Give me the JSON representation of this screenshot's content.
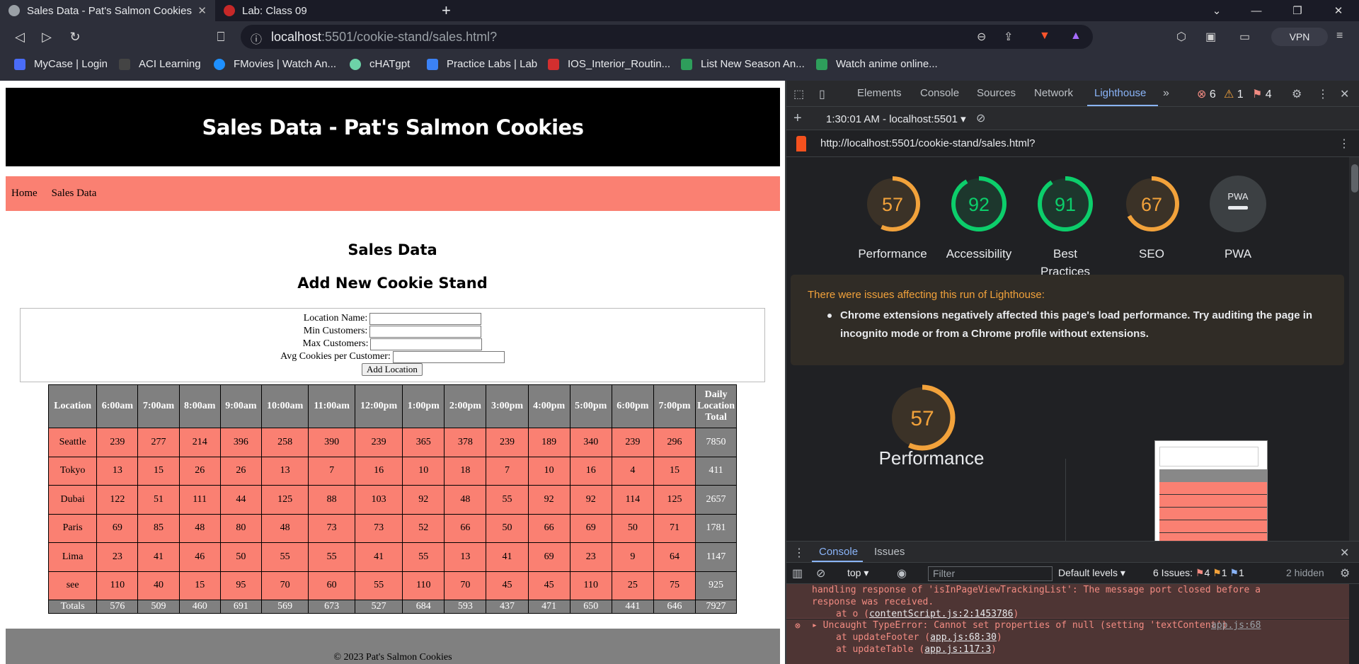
{
  "browser": {
    "tabs": [
      {
        "title": "Sales Data - Pat's Salmon Cookies",
        "active": true
      },
      {
        "title": "Lab: Class 09",
        "active": false
      }
    ],
    "new_tab_label": "+",
    "url_host": "localhost",
    "url_rest": ":5501/cookie-stand/sales.html?",
    "vpn_label": "VPN",
    "bookmarks": [
      "MyCase | Login",
      "ACI Learning",
      "FMovies | Watch An...",
      "cHATgpt",
      "Practice Labs | Lab",
      "IOS_Interior_Routin...",
      "List New Season An...",
      "Watch anime online..."
    ],
    "bookmark_colors": [
      "#4a6cf7",
      "#444444",
      "#1e90ff",
      "#6dd3a8",
      "#3b82f6",
      "#d32f2f",
      "#2e9e5b",
      "#2e9e5b"
    ]
  },
  "site": {
    "title": "Sales Data - Pat's Salmon Cookies",
    "nav": [
      "Home",
      "Sales Data"
    ],
    "heading_sales": "Sales Data",
    "heading_add": "Add New Cookie Stand",
    "form": {
      "location_label": "Location Name:",
      "min_label": "Min Customers:",
      "max_label": "Max Customers:",
      "avg_label": "Avg Cookies per Customer:",
      "submit_label": "Add Location"
    },
    "table": {
      "headers": [
        "Location",
        "6:00am",
        "7:00am",
        "8:00am",
        "9:00am",
        "10:00am",
        "11:00am",
        "12:00pm",
        "1:00pm",
        "2:00pm",
        "3:00pm",
        "4:00pm",
        "5:00pm",
        "6:00pm",
        "7:00pm",
        "Daily Location Total"
      ],
      "rows": [
        [
          "Seattle",
          "239",
          "277",
          "214",
          "396",
          "258",
          "390",
          "239",
          "365",
          "378",
          "239",
          "189",
          "340",
          "239",
          "296",
          "7850"
        ],
        [
          "Tokyo",
          "13",
          "15",
          "26",
          "26",
          "13",
          "7",
          "16",
          "10",
          "18",
          "7",
          "10",
          "16",
          "4",
          "15",
          "411"
        ],
        [
          "Dubai",
          "122",
          "51",
          "111",
          "44",
          "125",
          "88",
          "103",
          "92",
          "48",
          "55",
          "92",
          "92",
          "114",
          "125",
          "2657"
        ],
        [
          "Paris",
          "69",
          "85",
          "48",
          "80",
          "48",
          "73",
          "73",
          "52",
          "66",
          "50",
          "66",
          "69",
          "50",
          "71",
          "1781"
        ],
        [
          "Lima",
          "23",
          "41",
          "46",
          "50",
          "55",
          "55",
          "41",
          "55",
          "13",
          "41",
          "69",
          "23",
          "9",
          "64",
          "1147"
        ],
        [
          "see",
          "110",
          "40",
          "15",
          "95",
          "70",
          "60",
          "55",
          "110",
          "70",
          "45",
          "45",
          "110",
          "25",
          "75",
          "925"
        ]
      ],
      "totals": [
        "Totals",
        "576",
        "509",
        "460",
        "691",
        "569",
        "673",
        "527",
        "684",
        "593",
        "437",
        "471",
        "650",
        "441",
        "646",
        "7927"
      ]
    },
    "footer": "© 2023 Pat's Salmon Cookies"
  },
  "devtools": {
    "tabs": [
      "Elements",
      "Console",
      "Sources",
      "Network",
      "Lighthouse"
    ],
    "active_tab": "Lighthouse",
    "error_count": "6",
    "warning_count": "1",
    "issue_count": "4",
    "run_label": "1:30:01 AM - localhost:5501",
    "report_url": "http://localhost:5501/cookie-stand/sales.html?",
    "scores": [
      {
        "label": "Performance",
        "value": 57,
        "color": "#f2a23b"
      },
      {
        "label": "Accessibility",
        "value": 92,
        "color": "#0cce6b"
      },
      {
        "label": "Best Practices",
        "value": 91,
        "color": "#0cce6b"
      },
      {
        "label": "SEO",
        "value": 67,
        "color": "#f2a23b"
      },
      {
        "label": "PWA",
        "value": null,
        "color": "#9aa0a6"
      }
    ],
    "pwa_badge": "PWA",
    "warning_title": "There were issues affecting this run of Lighthouse:",
    "warning_item": "Chrome extensions negatively affected this page's load performance. Try auditing the page in incognito mode or from a Chrome profile without extensions.",
    "big_score": 57,
    "big_label": "Performance",
    "drawer": {
      "tabs": [
        "Console",
        "Issues"
      ],
      "context": "top",
      "filter_placeholder": "Filter",
      "levels": "Default levels",
      "issues_label": "6 Issues:",
      "issue_errors": "4",
      "issue_warnings": "1",
      "issue_info": "1",
      "hidden_label": "2 hidden",
      "msg1_line1": "handling response of 'isInPageViewTrackingList': The message port closed before a",
      "msg1_line2": "response was received.",
      "msg1_at": "at o (",
      "msg1_link": "contentScript.js:2:1453786",
      "msg2_line1": "Uncaught TypeError: Cannot set properties of null (setting 'textContent')",
      "msg2_src": "app.js:68",
      "msg2_at1": "at updateFooter (",
      "msg2_link1": "app.js:68:30",
      "msg2_at2": "at updateTable (",
      "msg2_link2": "app.js:117:3"
    }
  }
}
